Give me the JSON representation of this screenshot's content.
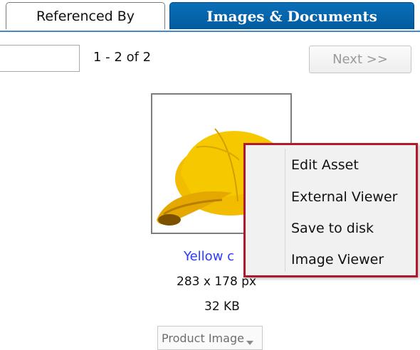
{
  "tabs": {
    "referenced_by": "Referenced By",
    "images_documents": "Images & Documents"
  },
  "pager": {
    "page_input_value": "",
    "count_text": "1 - 2 of 2",
    "next_label": "Next >>"
  },
  "asset": {
    "name": "Yellow c",
    "dimensions": "283 x 178 px",
    "size": "32 KB",
    "type_select": "Product Image"
  },
  "context_menu": {
    "items": [
      "Edit Asset",
      "External Viewer",
      "Save to disk",
      "Image Viewer"
    ]
  },
  "colors": {
    "active_tab": "#005b9e",
    "menu_border": "#b0192c",
    "link": "#2a3bf5",
    "cap": "#f2bd00"
  },
  "icons": {
    "select_arrow": "chevron-down-icon",
    "thumbnail": "yellow-cap-image"
  }
}
